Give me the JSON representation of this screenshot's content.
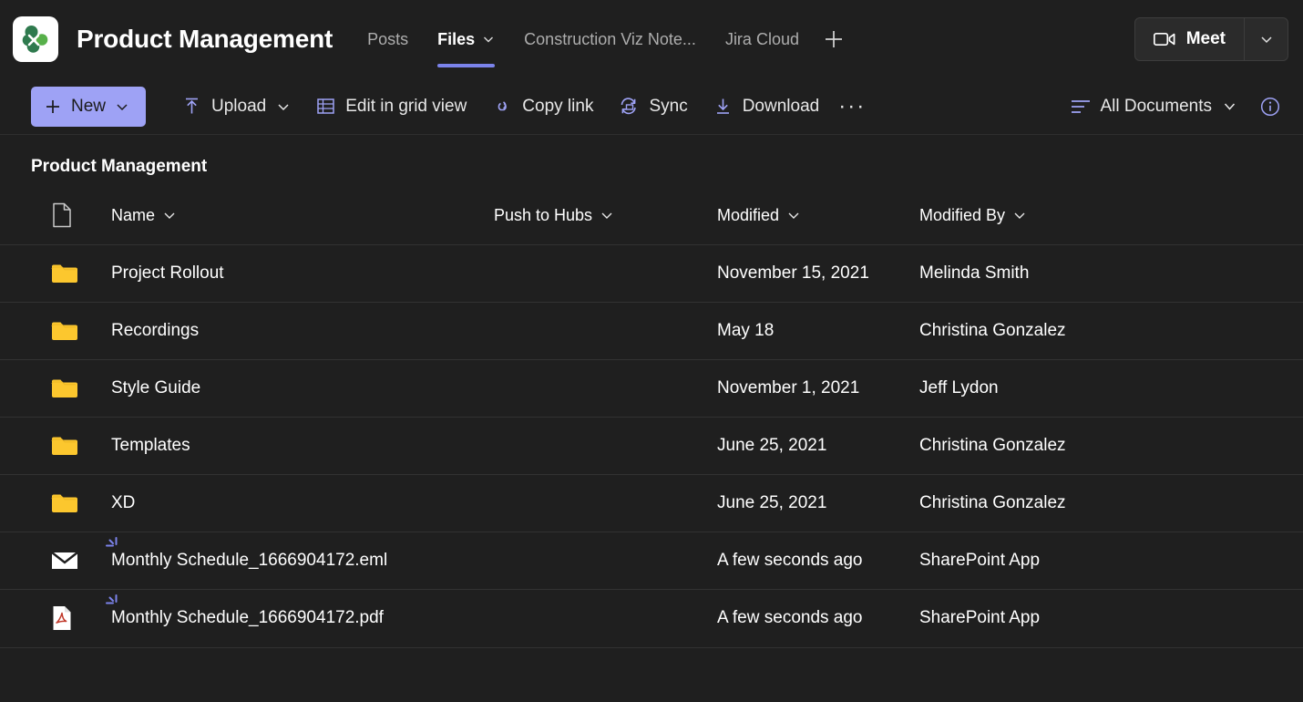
{
  "header": {
    "team_logo_icon": "clover-team-logo",
    "team_name": "Product Management",
    "tabs": [
      {
        "label": "Posts",
        "active": false,
        "has_chevron": false
      },
      {
        "label": "Files",
        "active": true,
        "has_chevron": true
      },
      {
        "label": "Construction Viz Note...",
        "active": false,
        "has_chevron": false
      },
      {
        "label": "Jira Cloud",
        "active": false,
        "has_chevron": false
      }
    ],
    "add_tab_icon": "plus-icon",
    "meet": {
      "label": "Meet",
      "icon": "video-camera-icon",
      "caret_icon": "chevron-down-icon"
    }
  },
  "commandbar": {
    "new": {
      "label": "New",
      "icon": "plus-icon",
      "caret_icon": "chevron-down-icon"
    },
    "items": [
      {
        "label": "Upload",
        "icon": "upload-arrow-icon",
        "has_caret": true
      },
      {
        "label": "Edit in grid view",
        "icon": "grid-table-icon",
        "has_caret": false
      },
      {
        "label": "Copy link",
        "icon": "chain-link-icon",
        "has_caret": false
      },
      {
        "label": "Sync",
        "icon": "sync-refresh-icon",
        "has_caret": false
      },
      {
        "label": "Download",
        "icon": "download-arrow-icon",
        "has_caret": false
      }
    ],
    "overflow_label": "···",
    "view": {
      "label": "All Documents",
      "icon": "list-lines-icon",
      "caret_icon": "chevron-down-icon"
    },
    "info_icon": "info-circle-icon"
  },
  "content": {
    "breadcrumb": "Product Management",
    "columns": {
      "icon": {
        "label": "",
        "icon": "document-icon"
      },
      "name": "Name",
      "push_to_hubs": "Push to Hubs",
      "modified": "Modified",
      "modified_by": "Modified By"
    },
    "rows": [
      {
        "icon": "folder-icon",
        "name": "Project Rollout",
        "push_to_hubs": "",
        "modified": "November 15, 2021",
        "modified_by": "Melinda Smith",
        "is_new": false
      },
      {
        "icon": "folder-icon",
        "name": "Recordings",
        "push_to_hubs": "",
        "modified": "May 18",
        "modified_by": "Christina Gonzalez",
        "is_new": false
      },
      {
        "icon": "folder-icon",
        "name": "Style Guide",
        "push_to_hubs": "",
        "modified": "November 1, 2021",
        "modified_by": "Jeff Lydon",
        "is_new": false
      },
      {
        "icon": "folder-icon",
        "name": "Templates",
        "push_to_hubs": "",
        "modified": "June 25, 2021",
        "modified_by": "Christina Gonzalez",
        "is_new": false
      },
      {
        "icon": "folder-icon",
        "name": "XD",
        "push_to_hubs": "",
        "modified": "June 25, 2021",
        "modified_by": "Christina Gonzalez",
        "is_new": false
      },
      {
        "icon": "email-icon",
        "name": "Monthly Schedule_1666904172.eml",
        "push_to_hubs": "",
        "modified": "A few seconds ago",
        "modified_by": "SharePoint App",
        "is_new": true
      },
      {
        "icon": "pdf-icon",
        "name": "Monthly Schedule_1666904172.pdf",
        "push_to_hubs": "",
        "modified": "A few seconds ago",
        "modified_by": "SharePoint App",
        "is_new": true
      }
    ]
  },
  "colors": {
    "page_background": "#1f1f1f",
    "accent_purple": "#7b83eb",
    "new_button": "#9ea2f5",
    "icon_purple": "#9ea2f5",
    "folder_yellow": "#fcc72e",
    "pdf_red": "#c0392b",
    "logo_green_dark": "#2f7a4e",
    "logo_green_light": "#57b04a",
    "row_divider": "#323232"
  }
}
